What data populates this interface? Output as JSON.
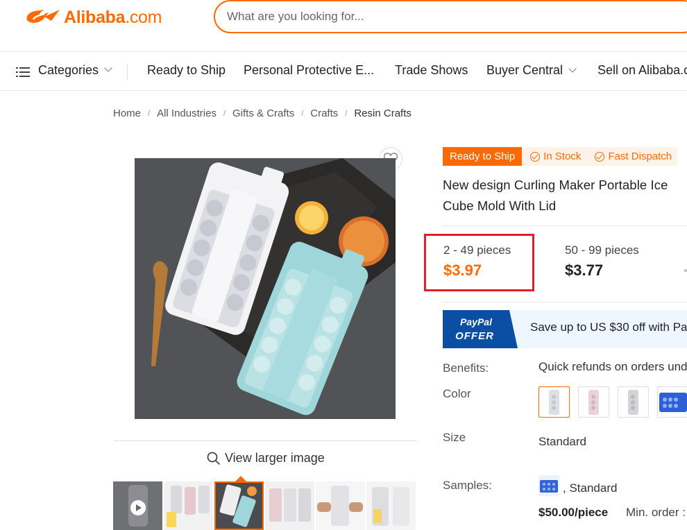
{
  "header": {
    "logo_brand": "Alibaba",
    "logo_suffix": ".com",
    "search_placeholder": "What are you looking for..."
  },
  "nav": {
    "categories": "Categories",
    "items": [
      "Ready to Ship",
      "Personal Protective E...",
      "Trade Shows",
      "Buyer Central",
      "Sell on Alibaba.c"
    ]
  },
  "breadcrumb": [
    "Home",
    "All Industries",
    "Gifts & Crafts",
    "Crafts",
    "Resin Crafts"
  ],
  "gallery": {
    "view_larger": "View larger image"
  },
  "product": {
    "badges": {
      "ready": "Ready to Ship",
      "in_stock": "In Stock",
      "fast_dispatch": "Fast Dispatch"
    },
    "title": "New design Curling Maker Portable Ice Cube Mold With Lid",
    "tiers": [
      {
        "range": "2 - 49 pieces",
        "price": "$3.97"
      },
      {
        "range": "50 - 99 pieces",
        "price": "$3.77"
      }
    ],
    "paypal": {
      "tag_top": "PayPal",
      "tag_bottom": "OFFER",
      "text": "Save up to US $30 off with Pa"
    },
    "benefits_label": "Benefits:",
    "benefits_value": "Quick refunds on orders und",
    "color_label": "Color",
    "size_label": "Size",
    "size_value": "Standard",
    "samples_label": "Samples:",
    "samples_value": ", Standard",
    "sample_price": "$50.00/piece",
    "sample_min": "Min. order :"
  },
  "colors": {
    "accent": "#ff6a00",
    "highlight": "#e41e26",
    "paypal_blue": "#0b4fa5"
  }
}
